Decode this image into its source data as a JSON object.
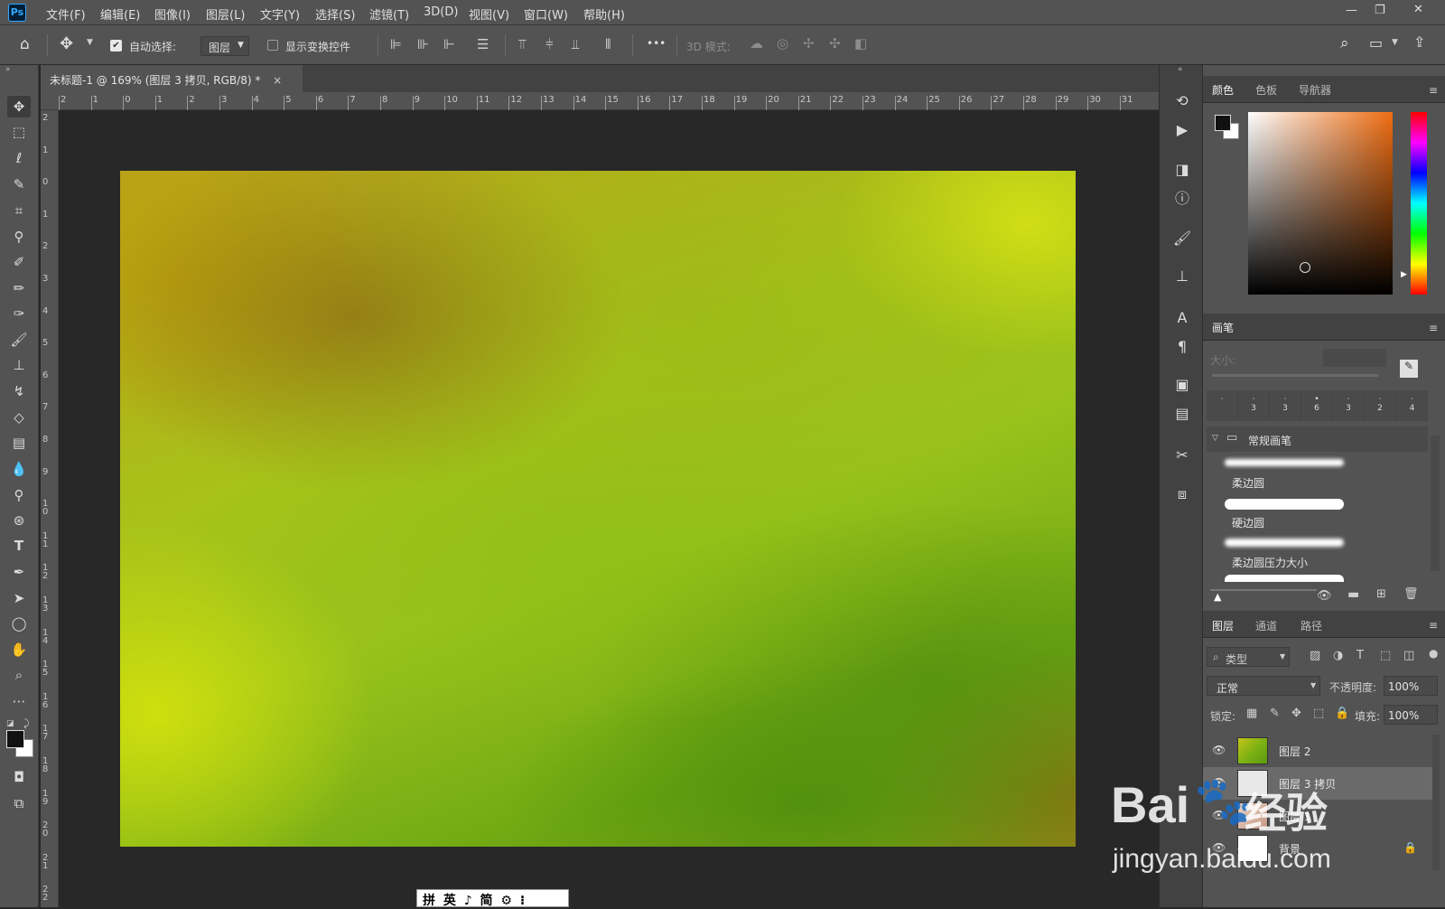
{
  "app": {
    "logo": "Ps",
    "window_controls": {
      "minimize": "—",
      "restore": "❐",
      "close": "✕"
    }
  },
  "menu": [
    "文件(F)",
    "编辑(E)",
    "图像(I)",
    "图层(L)",
    "文字(Y)",
    "选择(S)",
    "滤镜(T)",
    "3D(D)",
    "视图(V)",
    "窗口(W)",
    "帮助(H)"
  ],
  "options": {
    "auto_select_label": "自动选择:",
    "auto_select_value": "图层",
    "show_transform_label": "显示变换控件",
    "mode3d_label": "3D 模式:",
    "more": "•••"
  },
  "document": {
    "tab_title": "未标题-1 @ 169% (图层 3 拷贝, RGB/8) *",
    "close": "×"
  },
  "ruler": {
    "h": [
      "2",
      "1",
      "0",
      "1",
      "2",
      "3",
      "4",
      "5",
      "6",
      "7",
      "8",
      "9",
      "10",
      "11",
      "12",
      "13",
      "14",
      "15",
      "16",
      "17",
      "18",
      "19",
      "20",
      "21",
      "22",
      "23",
      "24",
      "25",
      "26",
      "27",
      "28",
      "29",
      "30",
      "31"
    ],
    "v": [
      "2",
      "1",
      "0",
      "1",
      "2",
      "3",
      "4",
      "5",
      "6",
      "7",
      "8",
      "9",
      "1 0",
      "1 1",
      "1 2",
      "1 3",
      "1 4",
      "1 5",
      "1 6",
      "1 7",
      "1 8",
      "1 9",
      "2 0",
      "2 1",
      "2 2"
    ]
  },
  "ime_bar": "拼 英 ♪ 简 ⚙ ⁝",
  "panels": {
    "color": {
      "tabs": [
        "颜色",
        "色板",
        "导航器"
      ]
    },
    "brush": {
      "title": "画笔",
      "size_label": "大小:",
      "tips": [
        " ",
        "3",
        "3",
        "6",
        "3",
        "2",
        "4"
      ],
      "group_label": "常规画笔",
      "presets": [
        "柔边圆",
        "硬边圆",
        "柔边圆压力大小"
      ]
    },
    "layers": {
      "tabs": [
        "图层",
        "通道",
        "路径"
      ],
      "filter_label": "类型",
      "blend_mode": "正常",
      "opacity_label": "不透明度:",
      "opacity_value": "100%",
      "lock_label": "锁定:",
      "fill_label": "填充:",
      "fill_value": "100%",
      "items": [
        {
          "name": "图层 2"
        },
        {
          "name": "图层 3 拷贝"
        },
        {
          "name": "图层 1"
        },
        {
          "name": "背景"
        }
      ]
    }
  },
  "watermark": {
    "brand": "Bai",
    "paw": "🐾",
    "suffix": "经验",
    "url": "jingyan.baidu.com"
  },
  "colors": {
    "ps_blue": "#31a8ff",
    "panel_bg": "#535353",
    "dark": "#282828"
  }
}
